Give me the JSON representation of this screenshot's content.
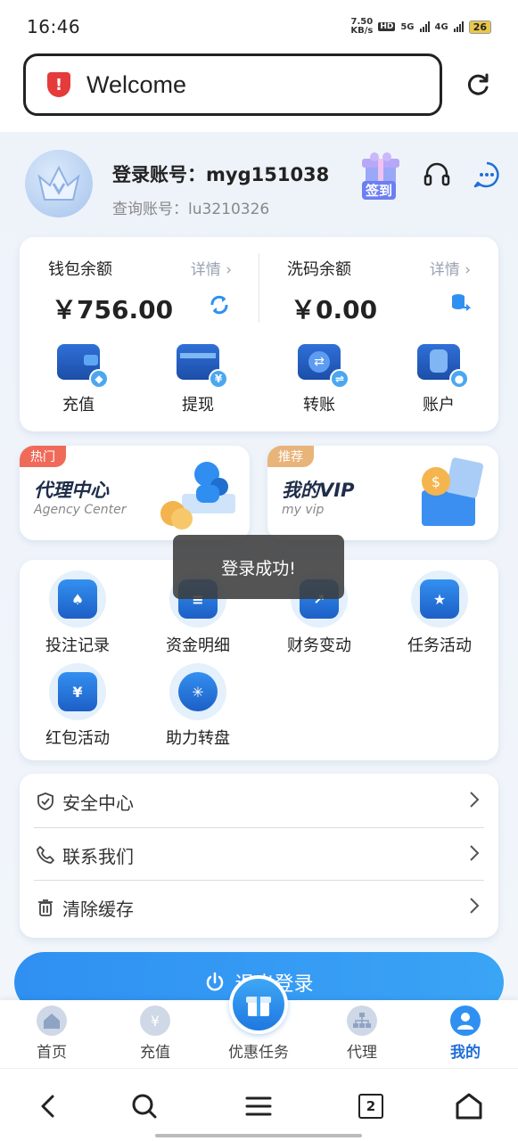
{
  "status_bar": {
    "time": "16:46",
    "speed_value": "7.50",
    "speed_unit": "KB/s",
    "hd": "HD",
    "net1": "5G",
    "net2": "4G",
    "battery": "26"
  },
  "browser": {
    "url_text": "Welcome"
  },
  "profile": {
    "login_account": "登录账号：myg151038",
    "query_account": "查询账号：lu3210326",
    "signin_label": "签到"
  },
  "wallet": {
    "balance_title": "钱包余额",
    "balance_detail": "详情 ›",
    "balance_amount": "￥756.00",
    "wash_title": "洗码余额",
    "wash_detail": "详情 ›",
    "wash_amount": "￥0.00",
    "actions": [
      {
        "label": "充值"
      },
      {
        "label": "提现"
      },
      {
        "label": "转账"
      },
      {
        "label": "账户"
      }
    ]
  },
  "promo": {
    "left_tag": "热门",
    "left_title": "代理中心",
    "left_sub": "Agency Center",
    "right_tag": "推荐",
    "right_title": "我的VIP",
    "right_sub": "my vip"
  },
  "grid": {
    "items": [
      {
        "label": "投注记录"
      },
      {
        "label": "资金明细"
      },
      {
        "label": "财务变动"
      },
      {
        "label": "任务活动"
      },
      {
        "label": "红包活动"
      },
      {
        "label": "助力转盘"
      }
    ]
  },
  "toast": {
    "text": "登录成功!"
  },
  "menu": {
    "items": [
      {
        "label": "安全中心"
      },
      {
        "label": "联系我们"
      },
      {
        "label": "清除缓存"
      }
    ]
  },
  "logout": {
    "label": "退出登录"
  },
  "tabbar": {
    "items": [
      {
        "label": "首页"
      },
      {
        "label": "充值"
      },
      {
        "label": "优惠任务"
      },
      {
        "label": "代理"
      },
      {
        "label": "我的"
      }
    ]
  },
  "navbar": {
    "tab_count": "2"
  },
  "colors": {
    "accent": "#2f90f2",
    "active_tab": "#1f6fd6",
    "hot_tag": "#f06a5a",
    "recommend_tag": "#e8b47a"
  }
}
